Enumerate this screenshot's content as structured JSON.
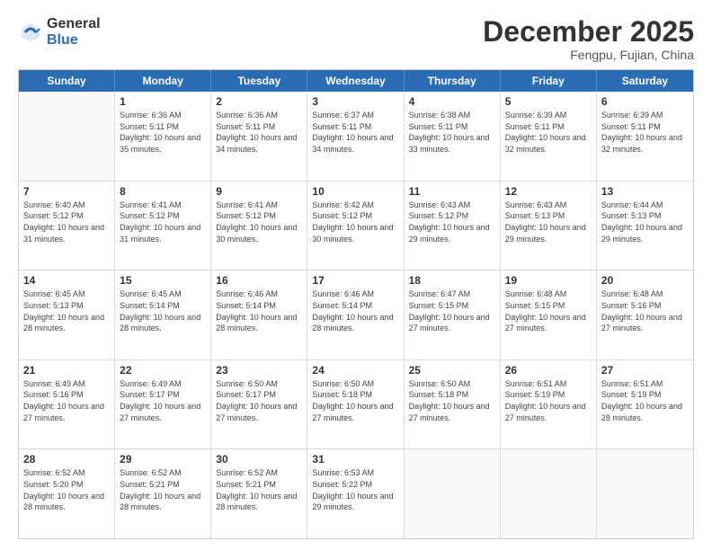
{
  "header": {
    "logo_general": "General",
    "logo_blue": "Blue",
    "month_title": "December 2025",
    "subtitle": "Fengpu, Fujian, China"
  },
  "weekdays": [
    "Sunday",
    "Monday",
    "Tuesday",
    "Wednesday",
    "Thursday",
    "Friday",
    "Saturday"
  ],
  "rows": [
    [
      {
        "day": "",
        "sunrise": "",
        "sunset": "",
        "daylight": ""
      },
      {
        "day": "1",
        "sunrise": "Sunrise: 6:36 AM",
        "sunset": "Sunset: 5:11 PM",
        "daylight": "Daylight: 10 hours and 35 minutes."
      },
      {
        "day": "2",
        "sunrise": "Sunrise: 6:36 AM",
        "sunset": "Sunset: 5:11 PM",
        "daylight": "Daylight: 10 hours and 34 minutes."
      },
      {
        "day": "3",
        "sunrise": "Sunrise: 6:37 AM",
        "sunset": "Sunset: 5:11 PM",
        "daylight": "Daylight: 10 hours and 34 minutes."
      },
      {
        "day": "4",
        "sunrise": "Sunrise: 6:38 AM",
        "sunset": "Sunset: 5:11 PM",
        "daylight": "Daylight: 10 hours and 33 minutes."
      },
      {
        "day": "5",
        "sunrise": "Sunrise: 6:39 AM",
        "sunset": "Sunset: 5:11 PM",
        "daylight": "Daylight: 10 hours and 32 minutes."
      },
      {
        "day": "6",
        "sunrise": "Sunrise: 6:39 AM",
        "sunset": "Sunset: 5:11 PM",
        "daylight": "Daylight: 10 hours and 32 minutes."
      }
    ],
    [
      {
        "day": "7",
        "sunrise": "Sunrise: 6:40 AM",
        "sunset": "Sunset: 5:12 PM",
        "daylight": "Daylight: 10 hours and 31 minutes."
      },
      {
        "day": "8",
        "sunrise": "Sunrise: 6:41 AM",
        "sunset": "Sunset: 5:12 PM",
        "daylight": "Daylight: 10 hours and 31 minutes."
      },
      {
        "day": "9",
        "sunrise": "Sunrise: 6:41 AM",
        "sunset": "Sunset: 5:12 PM",
        "daylight": "Daylight: 10 hours and 30 minutes."
      },
      {
        "day": "10",
        "sunrise": "Sunrise: 6:42 AM",
        "sunset": "Sunset: 5:12 PM",
        "daylight": "Daylight: 10 hours and 30 minutes."
      },
      {
        "day": "11",
        "sunrise": "Sunrise: 6:43 AM",
        "sunset": "Sunset: 5:12 PM",
        "daylight": "Daylight: 10 hours and 29 minutes."
      },
      {
        "day": "12",
        "sunrise": "Sunrise: 6:43 AM",
        "sunset": "Sunset: 5:13 PM",
        "daylight": "Daylight: 10 hours and 29 minutes."
      },
      {
        "day": "13",
        "sunrise": "Sunrise: 6:44 AM",
        "sunset": "Sunset: 5:13 PM",
        "daylight": "Daylight: 10 hours and 29 minutes."
      }
    ],
    [
      {
        "day": "14",
        "sunrise": "Sunrise: 6:45 AM",
        "sunset": "Sunset: 5:13 PM",
        "daylight": "Daylight: 10 hours and 28 minutes."
      },
      {
        "day": "15",
        "sunrise": "Sunrise: 6:45 AM",
        "sunset": "Sunset: 5:14 PM",
        "daylight": "Daylight: 10 hours and 28 minutes."
      },
      {
        "day": "16",
        "sunrise": "Sunrise: 6:46 AM",
        "sunset": "Sunset: 5:14 PM",
        "daylight": "Daylight: 10 hours and 28 minutes."
      },
      {
        "day": "17",
        "sunrise": "Sunrise: 6:46 AM",
        "sunset": "Sunset: 5:14 PM",
        "daylight": "Daylight: 10 hours and 28 minutes."
      },
      {
        "day": "18",
        "sunrise": "Sunrise: 6:47 AM",
        "sunset": "Sunset: 5:15 PM",
        "daylight": "Daylight: 10 hours and 27 minutes."
      },
      {
        "day": "19",
        "sunrise": "Sunrise: 6:48 AM",
        "sunset": "Sunset: 5:15 PM",
        "daylight": "Daylight: 10 hours and 27 minutes."
      },
      {
        "day": "20",
        "sunrise": "Sunrise: 6:48 AM",
        "sunset": "Sunset: 5:16 PM",
        "daylight": "Daylight: 10 hours and 27 minutes."
      }
    ],
    [
      {
        "day": "21",
        "sunrise": "Sunrise: 6:49 AM",
        "sunset": "Sunset: 5:16 PM",
        "daylight": "Daylight: 10 hours and 27 minutes."
      },
      {
        "day": "22",
        "sunrise": "Sunrise: 6:49 AM",
        "sunset": "Sunset: 5:17 PM",
        "daylight": "Daylight: 10 hours and 27 minutes."
      },
      {
        "day": "23",
        "sunrise": "Sunrise: 6:50 AM",
        "sunset": "Sunset: 5:17 PM",
        "daylight": "Daylight: 10 hours and 27 minutes."
      },
      {
        "day": "24",
        "sunrise": "Sunrise: 6:50 AM",
        "sunset": "Sunset: 5:18 PM",
        "daylight": "Daylight: 10 hours and 27 minutes."
      },
      {
        "day": "25",
        "sunrise": "Sunrise: 6:50 AM",
        "sunset": "Sunset: 5:18 PM",
        "daylight": "Daylight: 10 hours and 27 minutes."
      },
      {
        "day": "26",
        "sunrise": "Sunrise: 6:51 AM",
        "sunset": "Sunset: 5:19 PM",
        "daylight": "Daylight: 10 hours and 27 minutes."
      },
      {
        "day": "27",
        "sunrise": "Sunrise: 6:51 AM",
        "sunset": "Sunset: 5:19 PM",
        "daylight": "Daylight: 10 hours and 28 minutes."
      }
    ],
    [
      {
        "day": "28",
        "sunrise": "Sunrise: 6:52 AM",
        "sunset": "Sunset: 5:20 PM",
        "daylight": "Daylight: 10 hours and 28 minutes."
      },
      {
        "day": "29",
        "sunrise": "Sunrise: 6:52 AM",
        "sunset": "Sunset: 5:21 PM",
        "daylight": "Daylight: 10 hours and 28 minutes."
      },
      {
        "day": "30",
        "sunrise": "Sunrise: 6:52 AM",
        "sunset": "Sunset: 5:21 PM",
        "daylight": "Daylight: 10 hours and 28 minutes."
      },
      {
        "day": "31",
        "sunrise": "Sunrise: 6:53 AM",
        "sunset": "Sunset: 5:22 PM",
        "daylight": "Daylight: 10 hours and 29 minutes."
      },
      {
        "day": "",
        "sunrise": "",
        "sunset": "",
        "daylight": ""
      },
      {
        "day": "",
        "sunrise": "",
        "sunset": "",
        "daylight": ""
      },
      {
        "day": "",
        "sunrise": "",
        "sunset": "",
        "daylight": ""
      }
    ]
  ]
}
